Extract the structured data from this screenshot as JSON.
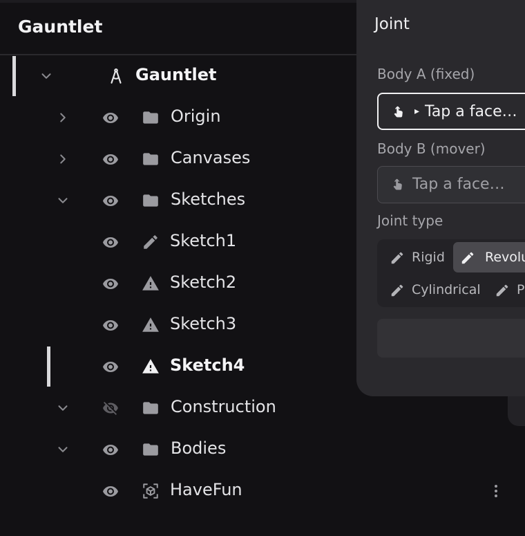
{
  "header": {
    "title": "Gauntlet"
  },
  "tree": {
    "root_label": "Gauntlet",
    "rows": [
      {
        "label": "Origin",
        "icon": "folder-icon",
        "expand": "collapsed",
        "visible": true
      },
      {
        "label": "Canvases",
        "icon": "folder-icon",
        "expand": "collapsed",
        "visible": true
      },
      {
        "label": "Sketches",
        "icon": "folder-icon",
        "expand": "expanded",
        "visible": true
      },
      {
        "label": "Sketch1",
        "icon": "pencil-icon",
        "expand": "none",
        "visible": true
      },
      {
        "label": "Sketch2",
        "icon": "warning-icon",
        "expand": "none",
        "visible": true
      },
      {
        "label": "Sketch3",
        "icon": "warning-icon",
        "expand": "none",
        "visible": true
      },
      {
        "label": "Sketch4",
        "icon": "warning-icon",
        "expand": "none",
        "visible": true,
        "selected": true
      },
      {
        "label": "Construction",
        "icon": "folder-icon",
        "expand": "expanded",
        "visible": false
      },
      {
        "label": "Bodies",
        "icon": "folder-icon",
        "expand": "expanded",
        "visible": true
      },
      {
        "label": "HaveFun",
        "icon": "body-cube-icon",
        "expand": "none",
        "visible": true
      }
    ]
  },
  "joint_panel": {
    "title": "Joint",
    "body_a": {
      "label": "Body A (fixed)",
      "placeholder": "Tap a face…",
      "icon": "tap-hand-icon"
    },
    "body_b": {
      "label": "Body B (mover)",
      "placeholder": "Tap a face…",
      "icon": "tap-hand-icon"
    },
    "joint_type": {
      "label": "Joint type",
      "options": [
        "Rigid",
        "Revolu",
        "Cylindrical",
        "P"
      ],
      "selected": "Revolu"
    }
  },
  "colors": {
    "background": "#121114",
    "panel": "#2a292d",
    "selected_indicator": "#d9d9dc",
    "icon_muted": "#9b9ba0"
  }
}
